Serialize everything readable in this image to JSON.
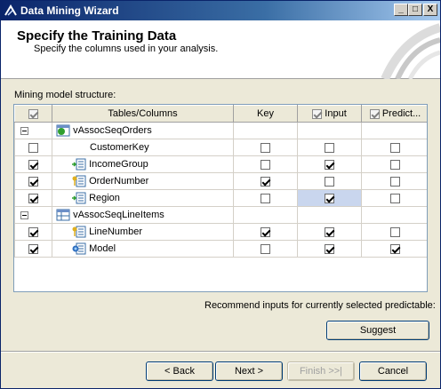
{
  "window": {
    "title": "Data Mining Wizard"
  },
  "header": {
    "heading": "Specify the Training Data",
    "subheading": "Specify the columns used in your analysis."
  },
  "structure_label": "Mining model structure:",
  "grid": {
    "columns": {
      "tables_columns": "Tables/Columns",
      "key": "Key",
      "input": "Input",
      "predict": "Predict..."
    },
    "rows": [
      {
        "name": "vAssocSeqOrders"
      },
      {
        "name": "CustomerKey"
      },
      {
        "name": "IncomeGroup"
      },
      {
        "name": "OrderNumber"
      },
      {
        "name": "Region"
      },
      {
        "name": "vAssocSeqLineItems"
      },
      {
        "name": "LineNumber"
      },
      {
        "name": "Model"
      }
    ]
  },
  "recommend_label": "Recommend inputs for currently selected predictable:",
  "buttons": {
    "suggest": "Suggest",
    "back": "< Back",
    "next": "Next >",
    "finish": "Finish >>|",
    "cancel": "Cancel"
  },
  "titlebar_buttons": {
    "minimize": "_",
    "maximize": "□",
    "close": "X"
  }
}
